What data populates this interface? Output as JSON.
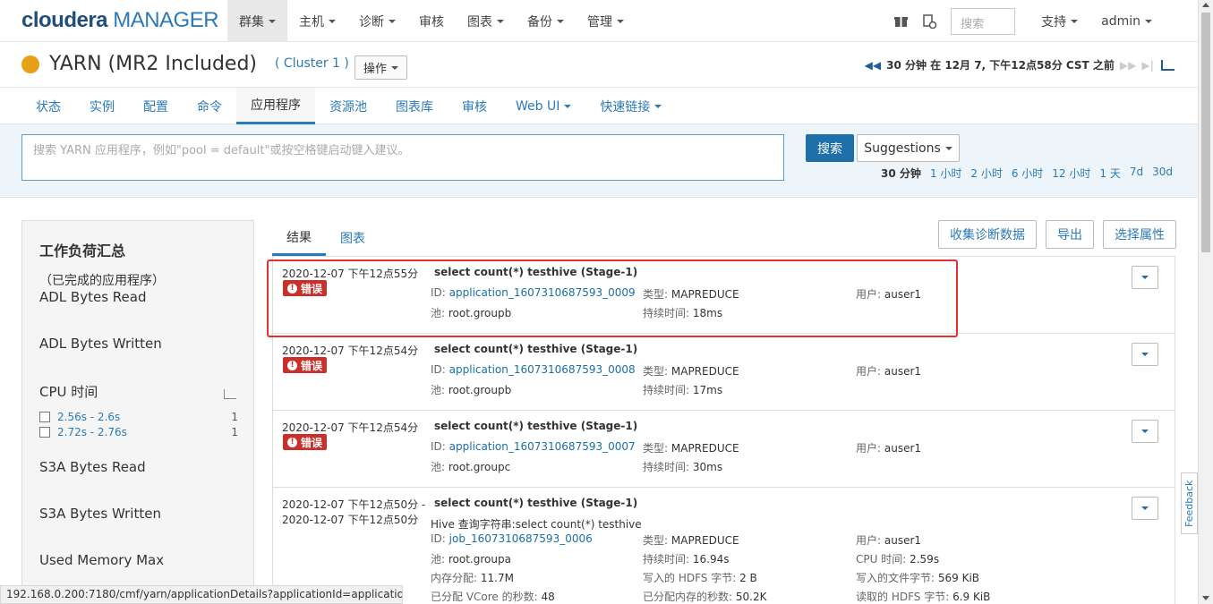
{
  "brand": {
    "name": "cloudera",
    "product": "MANAGER"
  },
  "topnav": {
    "items": [
      {
        "label": "群集",
        "caret": true
      },
      {
        "label": "主机",
        "caret": true
      },
      {
        "label": "诊断",
        "caret": true
      },
      {
        "label": "审核",
        "caret": false
      },
      {
        "label": "图表",
        "caret": true
      },
      {
        "label": "备份",
        "caret": true
      },
      {
        "label": "管理",
        "caret": true
      }
    ],
    "search_placeholder": "搜索",
    "support": "支持",
    "user": "admin"
  },
  "service": {
    "name": "YARN (MR2 Included)",
    "cluster": "( Cluster 1 )",
    "ops": "操作",
    "status_color": "#e8a117",
    "timeinfo": "30 分钟 在 12月 7, 下午12点58分 CST 之前"
  },
  "subnav": [
    "状态",
    "实例",
    "配置",
    "命令",
    "应用程序",
    "资源池",
    "图表库",
    "审核",
    "Web UI",
    "快速链接"
  ],
  "search": {
    "placeholder": "搜索 YARN 应用程序，例如\"pool = default\"或按空格键启动键入建议。",
    "button": "搜索",
    "suggestions": "Suggestions",
    "ranges": [
      "30 分钟",
      "1 小时",
      "2 小时",
      "6 小时",
      "12 小时",
      "1 天",
      "7d",
      "30d"
    ],
    "selected_range": "30 分钟"
  },
  "workload": {
    "title": "工作负荷汇总",
    "subtitle": "（已完成的应用程序）",
    "adl_read": "ADL Bytes Read",
    "adl_written": "ADL Bytes Written",
    "cpu": "CPU 时间",
    "cpu_ranges": [
      {
        "label": "2.56s - 2.6s",
        "count": "1"
      },
      {
        "label": "2.72s - 2.76s",
        "count": "1"
      }
    ],
    "s3a_read": "S3A Bytes Read",
    "s3a_written": "S3A Bytes Written",
    "mem_max": "Used Memory Max"
  },
  "results": {
    "tab_results": "结果",
    "tab_charts": "图表",
    "btn_collect": "收集诊断数据",
    "btn_export": "导出",
    "btn_attrs": "选择属性",
    "error_label": "错误",
    "k_id": "ID:",
    "k_pool": "池:",
    "k_type": "类型:",
    "k_duration": "持续时间:",
    "k_user": "用户:",
    "rows": [
      {
        "time": "2020-12-07 下午12点55分",
        "name": "select count(*) testhive (Stage-1)",
        "id": "application_1607310687593_0009",
        "pool": "root.groupb",
        "type": "MAPREDUCE",
        "duration": "18ms",
        "user": "auser1"
      },
      {
        "time": "2020-12-07 下午12点54分",
        "name": "select count(*) testhive (Stage-1)",
        "id": "application_1607310687593_0008",
        "pool": "root.groupb",
        "type": "MAPREDUCE",
        "duration": "17ms",
        "user": "auser1"
      },
      {
        "time": "2020-12-07 下午12点54分",
        "name": "select count(*) testhive (Stage-1)",
        "id": "application_1607310687593_0007",
        "pool": "root.groupc",
        "type": "MAPREDUCE",
        "duration": "30ms",
        "user": "auser1"
      }
    ],
    "last": {
      "time1": "2020-12-07 下午12点50分 -",
      "time2": "2020-12-07 下午12点50分",
      "name": "select count(*) testhive (Stage-1)",
      "hive_query": "Hive 查询字符串:select count(*) testhive",
      "id": "job_1607310687593_0006",
      "pool": "root.groupa",
      "mem_alloc_k": "内存分配:",
      "mem_alloc": "11.7M",
      "vcore_k": "已分配 VCore 的秒数:",
      "vcore": "48",
      "type": "MAPREDUCE",
      "duration": "16.94s",
      "hdfs_write_k": "写入的 HDFS 字节:",
      "hdfs_write": "2 B",
      "mem_sec_k": "已分配内存的秒数:",
      "mem_sec": "50.2K",
      "user": "auser1",
      "cpu_k": "CPU 时间:",
      "cpu": "2.59s",
      "file_write_k": "写入的文件字节:",
      "file_write": "569 KiB",
      "hdfs_read_k": "读取的 HDFS 字节:",
      "hdfs_read": "6.9 KiB"
    }
  },
  "feedback": "Feedback",
  "statusbar": "192.168.0.200:7180/cmf/yarn/applicationDetails?applicationId=application..."
}
